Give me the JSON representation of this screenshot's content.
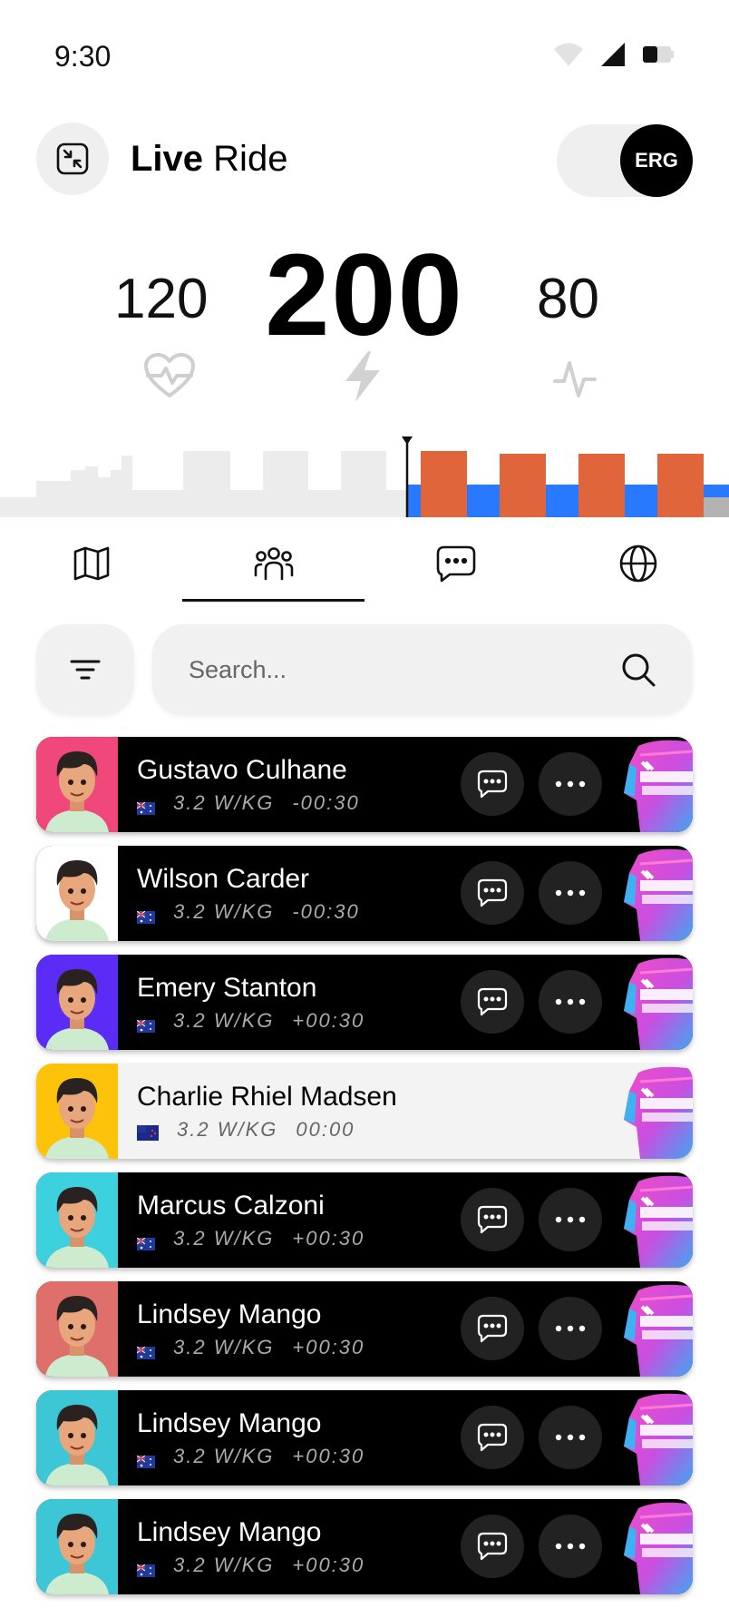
{
  "status_bar": {
    "time": "9:30",
    "icons": [
      "wifi-icon",
      "signal-icon",
      "battery-icon"
    ]
  },
  "header": {
    "title_bold": "Live",
    "title_rest": "Ride",
    "toggle_label": "ERG",
    "toggle_on": true
  },
  "metrics": {
    "heart_rate": "120",
    "power": "200",
    "cadence": "80"
  },
  "tabs": [
    {
      "name": "map",
      "icon": "map-icon"
    },
    {
      "name": "riders",
      "icon": "group-icon",
      "active": true
    },
    {
      "name": "chat",
      "icon": "chat-icon"
    },
    {
      "name": "world",
      "icon": "globe-icon"
    }
  ],
  "search": {
    "placeholder": "Search..."
  },
  "riders": [
    {
      "name": "Gustavo Culhane",
      "wkg": "3.2 W/KG",
      "gap": "-00:30",
      "avatar_color": "#f0487a",
      "flag": "AU"
    },
    {
      "name": "Wilson Carder",
      "wkg": "3.2 W/KG",
      "gap": "-00:30",
      "avatar_color": "#ffffff",
      "flag": "AU"
    },
    {
      "name": "Emery Stanton",
      "wkg": "3.2 W/KG",
      "gap": "+00:30",
      "avatar_color": "#5a2cf5",
      "flag": "AU"
    },
    {
      "name": "Charlie Rhiel Madsen",
      "wkg": "3.2 W/KG",
      "gap": "00:00",
      "avatar_color": "#fcc30a",
      "flag": "NZ",
      "self": true
    },
    {
      "name": "Marcus Calzoni",
      "wkg": "3.2 W/KG",
      "gap": "+00:30",
      "avatar_color": "#3dd0de",
      "flag": "AU"
    },
    {
      "name": "Lindsey Mango",
      "wkg": "3.2 W/KG",
      "gap": "+00:30",
      "avatar_color": "#df6f6a",
      "flag": "AU"
    },
    {
      "name": "Lindsey Mango",
      "wkg": "3.2 W/KG",
      "gap": "+00:30",
      "avatar_color": "#3cc6d6",
      "flag": "AU"
    },
    {
      "name": "Lindsey Mango",
      "wkg": "3.2 W/KG",
      "gap": "+00:30",
      "avatar_color": "#3cc6d6",
      "flag": "AU"
    }
  ],
  "colors": {
    "effort_bar": "#e0653a",
    "recovery_bar": "#2979ff",
    "completed": "#ececec",
    "remaining": "#b3b3b3"
  }
}
